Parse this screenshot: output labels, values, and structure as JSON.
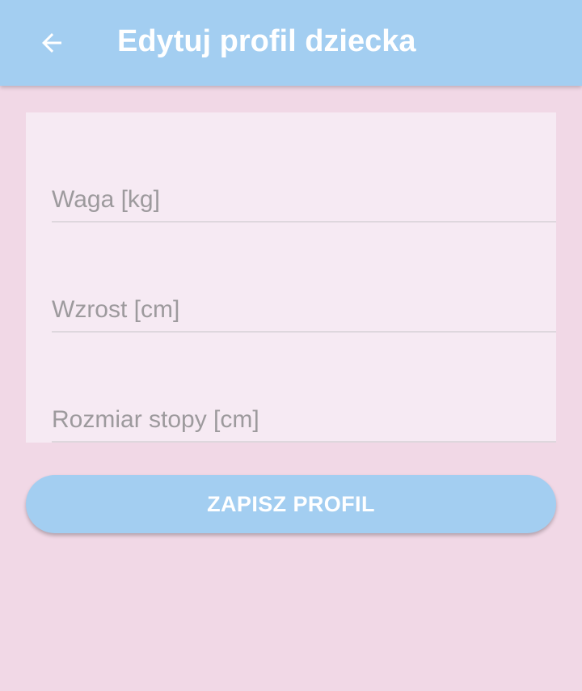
{
  "app_bar": {
    "title": "Edytuj profil dziecka",
    "back_icon": "arrow-left-icon",
    "background_color": "#a3cef1"
  },
  "form": {
    "fields": [
      {
        "placeholder": "Waga [kg]",
        "value": ""
      },
      {
        "placeholder": "Wzrost [cm]",
        "value": ""
      },
      {
        "placeholder": "Rozmiar stopy [cm]",
        "value": ""
      }
    ]
  },
  "actions": {
    "save_label": "ZAPISZ PROFIL"
  },
  "colors": {
    "page_background": "#f1d8e6",
    "card_background": "#f6eaf3",
    "accent": "#a3cef1",
    "placeholder_text": "#9d9a9d"
  }
}
